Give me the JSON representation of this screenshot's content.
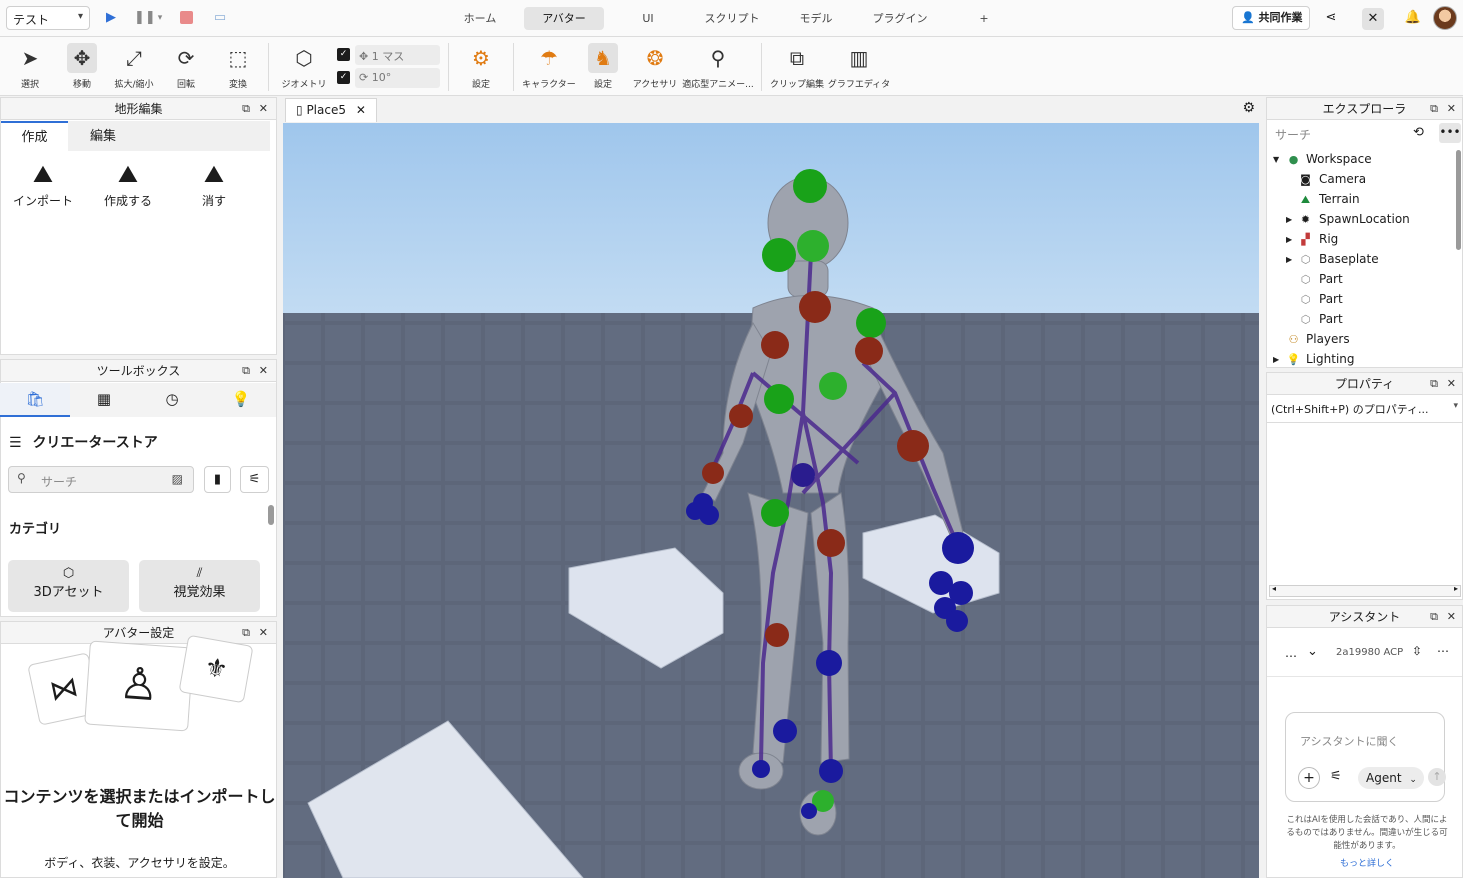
{
  "topbar": {
    "mode": "テスト",
    "tabs": [
      "ホーム",
      "アバター",
      "UI",
      "スクリプト",
      "モデル",
      "プラグイン",
      "+"
    ],
    "active_tab": "アバター",
    "collab_label": "共同作業"
  },
  "ribbon": {
    "tools": [
      {
        "label": "選択",
        "icon": "cursor-icon"
      },
      {
        "label": "移動",
        "icon": "move-icon"
      },
      {
        "label": "拡大/縮小",
        "icon": "scale-icon"
      },
      {
        "label": "回転",
        "icon": "rotate-icon"
      },
      {
        "label": "変換",
        "icon": "transform-icon"
      },
      {
        "label": "ジオメトリ",
        "icon": "geometry-icon"
      },
      {
        "label": "設定",
        "icon": "avatar-settings-icon"
      },
      {
        "label": "キャラクター",
        "icon": "character-icon"
      },
      {
        "label": "設定",
        "icon": "rig-settings-icon"
      },
      {
        "label": "アクセサリ",
        "icon": "accessory-icon"
      },
      {
        "label": "適応型アニメー...",
        "icon": "adaptive-animation-icon"
      },
      {
        "label": "クリップ編集",
        "icon": "clip-edit-icon"
      },
      {
        "label": "グラフエディタ",
        "icon": "graph-editor-icon"
      }
    ],
    "move_snap": "1 マス",
    "rotate_snap": "10°"
  },
  "terrain": {
    "title": "地形編集",
    "tabs": [
      "作成",
      "編集"
    ],
    "buttons": [
      "インポート",
      "作成する",
      "消す"
    ]
  },
  "toolbox": {
    "title": "ツールボックス",
    "store_title": "クリエーターストア",
    "search_placeholder": "サーチ",
    "category_heading": "カテゴリ",
    "categories": [
      "3Dアセット",
      "視覚効果"
    ]
  },
  "avatar_settings": {
    "title": "アバター設定",
    "headline": "コンテンツを選択またはインポートして開始",
    "subtext": "ボディ、衣装、アクセサリを設定。"
  },
  "viewport": {
    "tab_label": "Place5"
  },
  "explorer": {
    "title": "エクスプローラ",
    "search_placeholder": "サーチ",
    "items": [
      {
        "label": "Workspace",
        "indent": 0,
        "arrow": "open",
        "icon": "globe-icon"
      },
      {
        "label": "Camera",
        "indent": 1,
        "arrow": "",
        "icon": "camera-icon"
      },
      {
        "label": "Terrain",
        "indent": 1,
        "arrow": "",
        "icon": "terrain-icon"
      },
      {
        "label": "SpawnLocation",
        "indent": 1,
        "arrow": "closed",
        "icon": "spawn-icon"
      },
      {
        "label": "Rig",
        "indent": 1,
        "arrow": "closed",
        "icon": "model-icon"
      },
      {
        "label": "Baseplate",
        "indent": 1,
        "arrow": "closed",
        "icon": "part-icon"
      },
      {
        "label": "Part",
        "indent": 1,
        "arrow": "",
        "icon": "part-icon"
      },
      {
        "label": "Part",
        "indent": 1,
        "arrow": "",
        "icon": "part-icon"
      },
      {
        "label": "Part",
        "indent": 1,
        "arrow": "",
        "icon": "part-icon"
      },
      {
        "label": "Players",
        "indent": 0,
        "arrow": "",
        "icon": "players-icon"
      },
      {
        "label": "Lighting",
        "indent": 0,
        "arrow": "closed",
        "icon": "lighting-icon"
      }
    ]
  },
  "properties": {
    "title": "プロパティ",
    "filter": "(Ctrl+Shift+P) のプロパティ..."
  },
  "assistant": {
    "title": "アシスタント",
    "session": "2a19980 ACP",
    "input_placeholder": "アシスタントに聞く",
    "mode": "Agent",
    "disclaimer": "これはAIを使用した会話であり、人間によるものではありません。間違いが生じる可能性があります。",
    "learn_more": "もっと詳しく"
  }
}
